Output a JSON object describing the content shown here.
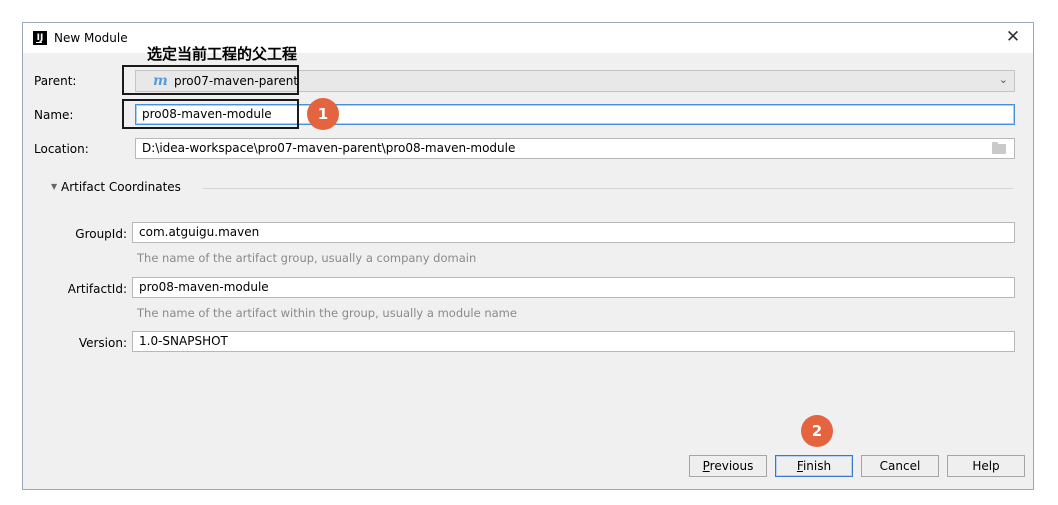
{
  "window": {
    "title": "New Module",
    "close_glyph": "✕"
  },
  "annotation": {
    "title": "选定当前工程的父工程",
    "badge1": "1",
    "badge2": "2"
  },
  "form": {
    "parent_label": "Parent:",
    "parent_value": "pro07-maven-parent",
    "parent_icon_glyph": "m",
    "name_label": "Name:",
    "name_value": "pro08-maven-module",
    "location_label": "Location:",
    "location_value": "D:\\idea-workspace\\pro07-maven-parent\\pro08-maven-module"
  },
  "artifact": {
    "section_label": "Artifact Coordinates",
    "groupid_label": "GroupId:",
    "groupid_value": "com.atguigu.maven",
    "groupid_hint": "The name of the artifact group, usually a company domain",
    "artifactid_label": "ArtifactId:",
    "artifactid_value": "pro08-maven-module",
    "artifactid_hint": "The name of the artifact within the group, usually a module name",
    "version_label": "Version:",
    "version_value": "1.0-SNAPSHOT"
  },
  "buttons": {
    "previous_mnemonic": "P",
    "previous_rest": "revious",
    "finish_mnemonic": "F",
    "finish_rest": "inish",
    "cancel": "Cancel",
    "help": "Help"
  },
  "colors": {
    "accent": "#4a90d9",
    "badge": "#e3643f",
    "maven_icon": "#5b9bd5"
  }
}
